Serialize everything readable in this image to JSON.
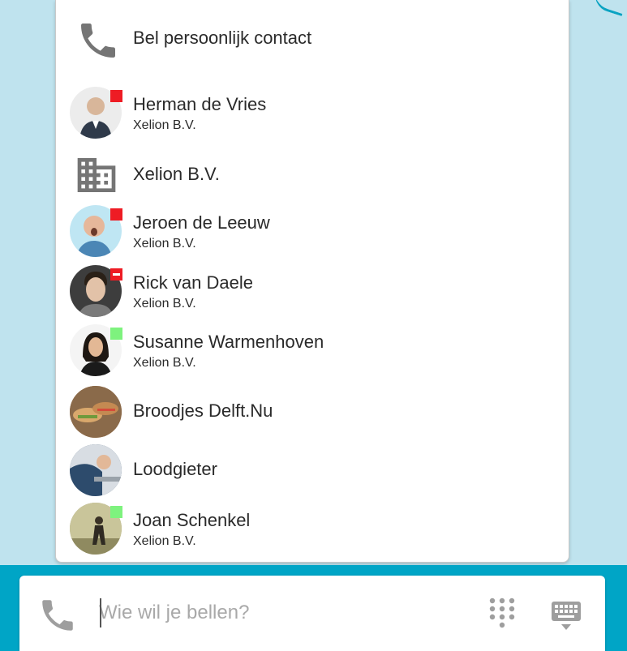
{
  "personal_contact": {
    "label": "Bel persoonlijk contact",
    "icon": "phone-icon"
  },
  "contacts": [
    {
      "name": "Herman de Vries",
      "company": "Xelion B.V.",
      "status": "busy",
      "avatar_color": "#d8c6b4"
    },
    {
      "name": "Xelion B.V.",
      "company": "",
      "type": "organization",
      "icon": "building-icon"
    },
    {
      "name": "Jeroen de Leeuw",
      "company": "Xelion B.V.",
      "status": "busy",
      "avatar_color": "#9fd3e6"
    },
    {
      "name": "Rick van Daele",
      "company": "Xelion B.V.",
      "status": "do-not-disturb",
      "avatar_color": "#5a5a5a"
    },
    {
      "name": "Susanne Warmenhoven",
      "company": "Xelion B.V.",
      "status": "available",
      "avatar_color": "#f4f4f4"
    },
    {
      "name": "Broodjes Delft.Nu",
      "company": "",
      "avatar_color": "#b07a4c"
    },
    {
      "name": "Loodgieter",
      "company": "",
      "avatar_color": "#3b5670"
    },
    {
      "name": "Joan Schenkel",
      "company": "Xelion B.V.",
      "status": "available",
      "avatar_color": "#a4a37a"
    }
  ],
  "search": {
    "placeholder": "Wie wil je bellen?",
    "value": ""
  },
  "toolbar": {
    "dialpad_icon": "dialpad-icon",
    "keyboard_icon": "keyboard-icon"
  },
  "colors": {
    "background": "#bfe3ee",
    "accent": "#00a5c6",
    "busy": "#ee1c24",
    "available": "#7ef27e"
  }
}
